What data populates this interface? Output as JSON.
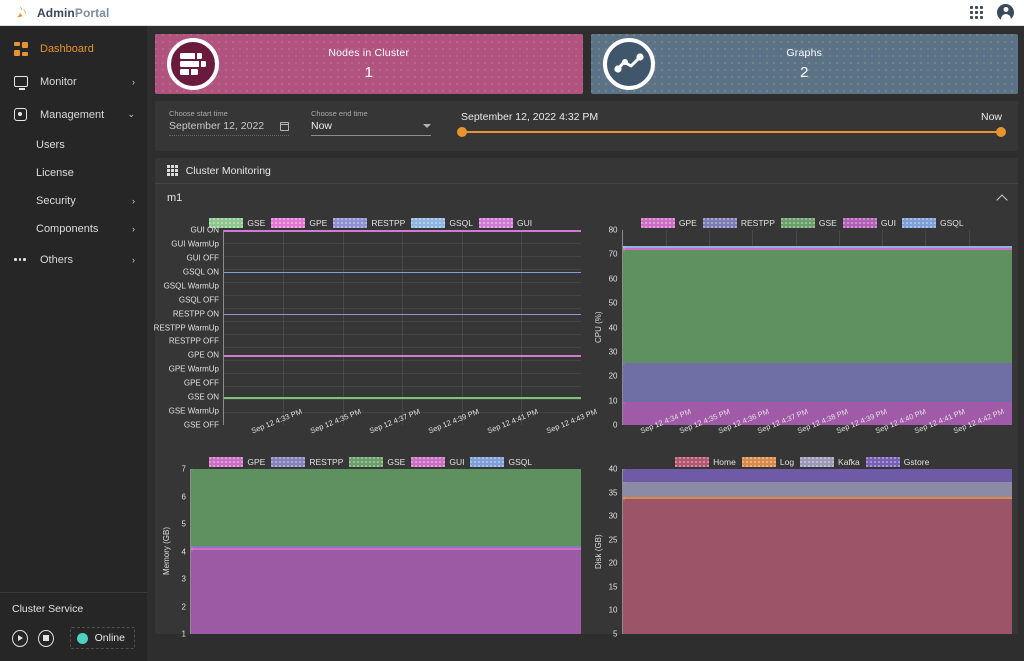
{
  "topbar": {
    "brand_bold": "Admin",
    "brand_light": "Portal",
    "apps_icon": "grid-apps-icon",
    "account_icon": "user-account-icon"
  },
  "sidebar": {
    "items": [
      {
        "label": "Dashboard",
        "icon": "dashboard-icon",
        "chevron": "",
        "active": true
      },
      {
        "label": "Monitor",
        "icon": "monitor-icon",
        "chevron": "›",
        "active": false
      },
      {
        "label": "Management",
        "icon": "management-icon",
        "chevron": "⌄",
        "active": false
      }
    ],
    "sub_items": [
      {
        "label": "Users",
        "chevron": ""
      },
      {
        "label": "License",
        "chevron": ""
      },
      {
        "label": "Security",
        "chevron": "›"
      },
      {
        "label": "Components",
        "chevron": "›"
      }
    ],
    "others": {
      "label": "Others",
      "icon": "ellipsis-icon",
      "chevron": "›"
    },
    "cluster_service": {
      "title": "Cluster Service",
      "start_icon": "play-button-icon",
      "stop_icon": "stop-button-icon",
      "status_label": "Online",
      "status_color": "#4fd1c0"
    }
  },
  "cards": [
    {
      "title": "Nodes in Cluster",
      "value": "1",
      "icon": "server-stack-icon",
      "color": "#b0537f"
    },
    {
      "title": "Graphs",
      "value": "2",
      "icon": "graph-line-icon",
      "color": "#5c7287"
    }
  ],
  "timebar": {
    "start": {
      "label": "Choose start time",
      "value": "September 12, 2022",
      "icon": "calendar-icon"
    },
    "end": {
      "label": "Choose end time",
      "value": "Now",
      "icon": "chevron-down-icon"
    },
    "slider_left_label": "September 12, 2022 4:32 PM",
    "slider_right_label": "Now",
    "accent": "#e8932f"
  },
  "panel": {
    "title": "Cluster Monitoring",
    "icon": "waffle-grid-icon",
    "node": "m1",
    "collapse_icon": "chevron-up-icon"
  },
  "chart_data": [
    {
      "id": "service-status",
      "type": "line",
      "title": "",
      "xlabel": "",
      "ylabel": "",
      "legend": [
        {
          "name": "GSE",
          "color": "#8dc78d"
        },
        {
          "name": "GPE",
          "color": "#e07ad0"
        },
        {
          "name": "RESTPP",
          "color": "#8f8fd4"
        },
        {
          "name": "GSQL",
          "color": "#8fb4e0"
        },
        {
          "name": "GUI",
          "color": "#d07ad6"
        }
      ],
      "ytick_labels": [
        "GUI ON",
        "GUI WarmUp",
        "GUI OFF",
        "GSQL ON",
        "GSQL WarmUp",
        "GSQL OFF",
        "RESTPP ON",
        "RESTPP WarmUp",
        "RESTPP OFF",
        "GPE ON",
        "GPE WarmUp",
        "GPE OFF",
        "GSE ON",
        "GSE WarmUp",
        "GSE OFF"
      ],
      "xtick_labels": [
        "Sep 12 4:33 PM",
        "Sep 12 4:35 PM",
        "Sep 12 4:37 PM",
        "Sep 12 4:39 PM",
        "Sep 12 4:41 PM",
        "Sep 12 4:43 PM"
      ],
      "series": [
        {
          "name": "GUI",
          "value_label": "GUI ON",
          "color": "#d07ad6"
        },
        {
          "name": "GSQL",
          "value_label": "GSQL ON",
          "color": "#7e9fd8"
        },
        {
          "name": "RESTPP",
          "value_label": "RESTPP ON",
          "color": "#9a8fd8"
        },
        {
          "name": "GPE",
          "value_label": "GPE ON",
          "color": "#d07ad6"
        },
        {
          "name": "GSE",
          "value_label": "GSE ON",
          "color": "#7cc47c"
        }
      ]
    },
    {
      "id": "cpu",
      "type": "area",
      "title": "",
      "xlabel": "",
      "ylabel": "CPU (%)",
      "ylim": [
        0,
        80
      ],
      "ytick_labels": [
        "80",
        "70",
        "60",
        "50",
        "40",
        "30",
        "20",
        "10",
        "0"
      ],
      "xtick_labels": [
        "Sep 12 4:34 PM",
        "Sep 12 4:35 PM",
        "Sep 12 4:36 PM",
        "Sep 12 4:37 PM",
        "Sep 12 4:38 PM",
        "Sep 12 4:39 PM",
        "Sep 12 4:40 PM",
        "Sep 12 4:41 PM",
        "Sep 12 4:42 PM"
      ],
      "legend": [
        {
          "name": "GPE",
          "color": "#cc6fc4"
        },
        {
          "name": "RESTPP",
          "color": "#7d7db5"
        },
        {
          "name": "GSE",
          "color": "#6a9e6a"
        },
        {
          "name": "GUI",
          "color": "#b35fb8"
        },
        {
          "name": "GSQL",
          "color": "#7e9fd8"
        }
      ],
      "stack": [
        {
          "name": "GUI",
          "value": 9.3,
          "color": "#a05aa8"
        },
        {
          "name": "RESTPP",
          "value": 16.0,
          "color": "#6f6fa5"
        },
        {
          "name": "GSE",
          "value": 46.5,
          "color": "#5f9060"
        },
        {
          "name": "GPE",
          "value": 0.8,
          "color": "#cc6fc4"
        },
        {
          "name": "GSQL",
          "value": 0.9,
          "color": "#8fb4e0"
        }
      ],
      "total": 73.5
    },
    {
      "id": "memory",
      "type": "area",
      "title": "",
      "xlabel": "",
      "ylabel": "Memory (GB)",
      "ylim": [
        1,
        7
      ],
      "ytick_labels": [
        "7",
        "6",
        "5",
        "4",
        "3",
        "2",
        "1"
      ],
      "xtick_labels": [],
      "legend": [
        {
          "name": "GPE",
          "color": "#cc6fc4"
        },
        {
          "name": "RESTPP",
          "color": "#8484bb"
        },
        {
          "name": "GSE",
          "color": "#6a9e6a"
        },
        {
          "name": "GUI",
          "color": "#cc6fc4"
        },
        {
          "name": "GSQL",
          "color": "#7e9fd8"
        }
      ],
      "stack": [
        {
          "name": "GUI",
          "value": 3.05,
          "color": "#9c5aa4"
        },
        {
          "name": "GPE",
          "value": 0.06,
          "color": "#cc6fc4"
        },
        {
          "name": "RESTPP",
          "value": 0.09,
          "color": "#7d7db5"
        },
        {
          "name": "GSE",
          "value": 3.05,
          "color": "#5f9060"
        },
        {
          "name": "GSQL",
          "value": 0.75,
          "color": "#6f7da0"
        }
      ],
      "total": 7.0
    },
    {
      "id": "disk",
      "type": "area",
      "title": "",
      "xlabel": "",
      "ylabel": "Disk (GB)",
      "ylim": [
        5,
        40
      ],
      "ytick_labels": [
        "40",
        "35",
        "30",
        "25",
        "20",
        "15",
        "10",
        "5"
      ],
      "xtick_labels": [],
      "legend": [
        {
          "name": "Home",
          "color": "#b5566f"
        },
        {
          "name": "Log",
          "color": "#d98a4a"
        },
        {
          "name": "Kafka",
          "color": "#9a9ab8"
        },
        {
          "name": "Gstore",
          "color": "#7a5fb8"
        }
      ],
      "stack": [
        {
          "name": "Home",
          "value": 28.7,
          "color": "#9c5568"
        },
        {
          "name": "Log",
          "value": 0.3,
          "color": "#d98a4a"
        },
        {
          "name": "Kafka",
          "value": 3.2,
          "color": "#8b8ba6"
        },
        {
          "name": "Gstore",
          "value": 5.6,
          "color": "#6f5aa8"
        }
      ],
      "total": 37.8
    }
  ]
}
